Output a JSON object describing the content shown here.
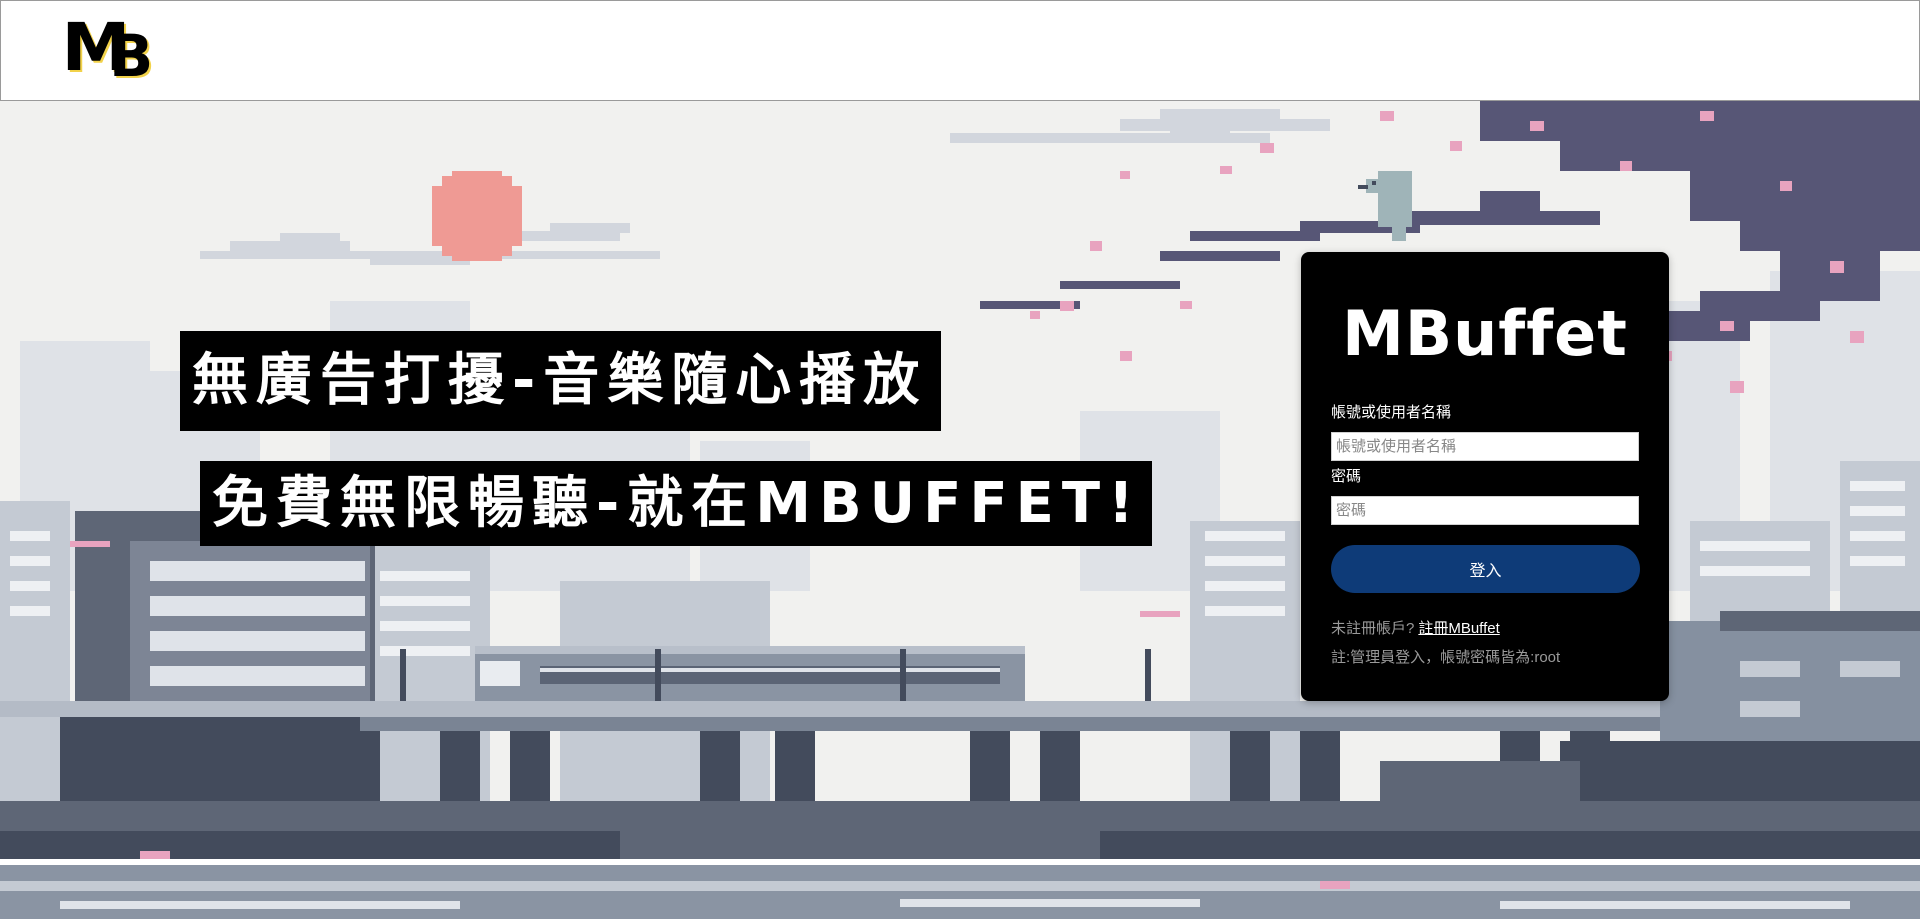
{
  "header": {
    "logo_text_m": "M",
    "logo_text_b": "B"
  },
  "hero": {
    "slogan_1": "無廣告打擾-音樂隨心播放",
    "slogan_2": "免費無限暢聽-就在MBUFFET!"
  },
  "login": {
    "brand": "MBuffet",
    "username_label": "帳號或使用者名稱",
    "username_placeholder": "帳號或使用者名稱",
    "username_value": "",
    "password_label": "密碼",
    "password_placeholder": "密碼",
    "password_value": "",
    "submit_label": "登入",
    "register_prompt": "未註冊帳戶?",
    "register_link": "註冊MBuffet",
    "note": "註:管理員登入，帳號密碼皆為:root"
  },
  "colors": {
    "card_bg": "#000000",
    "button_bg": "#0e3b78",
    "sun": "#ef9a94",
    "blossom": "#e8a3bf",
    "branch": "#575676",
    "building_dark": "#434b5c",
    "building_mid": "#8590a0",
    "building_light": "#c4cad3"
  },
  "icons": {
    "logo": "mb-logo",
    "bird": "bird-illustration",
    "sun": "sun-illustration"
  }
}
